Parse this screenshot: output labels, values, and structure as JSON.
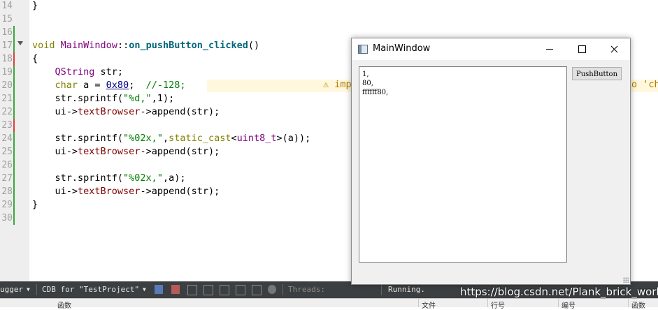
{
  "editor": {
    "lines": [
      {
        "num": "14",
        "text": "}"
      },
      {
        "num": "15",
        "text": ""
      },
      {
        "num": "16",
        "text": ""
      },
      {
        "num": "17",
        "text": "void MainWindow::on_pushButton_clicked()"
      },
      {
        "num": "18",
        "text": "{"
      },
      {
        "num": "19",
        "text": "    QString str;"
      },
      {
        "num": "20",
        "text": "    char a = 0x80;  //-128;"
      },
      {
        "num": "21",
        "text": "    str.sprintf(\"%d,\",1);"
      },
      {
        "num": "22",
        "text": "    ui->textBrowser->append(str);"
      },
      {
        "num": "23",
        "text": ""
      },
      {
        "num": "24",
        "text": "    str.sprintf(\"%02x,\",static_cast<uint8_t>(a));"
      },
      {
        "num": "25",
        "text": "    ui->textBrowser->append(str);"
      },
      {
        "num": "26",
        "text": ""
      },
      {
        "num": "27",
        "text": "    str.sprintf(\"%02x,\",a);"
      },
      {
        "num": "28",
        "text": "    ui->textBrowser->append(str);"
      },
      {
        "num": "29",
        "text": "}"
      },
      {
        "num": "30",
        "text": ""
      }
    ],
    "warning_left": "⚠ imp",
    "warning_right": "o 'ch"
  },
  "window": {
    "title": "MainWindow",
    "text_browser_lines": [
      "1,",
      "80,",
      "ffffff80,"
    ],
    "push_button_label": "PushButton"
  },
  "statusbar": {
    "debugger": "ugger",
    "engine": "CDB for \"TestProject\"",
    "threads_label": "Threads:",
    "status": "Running."
  },
  "bottom_header": {
    "col1": "函数",
    "col2": "文件",
    "col3": "行号",
    "col4": "编号",
    "col5": "函数"
  },
  "watermark": "https://blog.csdn.net/Plank_brick_work",
  "colors": {
    "keyword": "#808000",
    "function": "#00677c",
    "type": "#800080",
    "member": "#800000",
    "string": "#008000",
    "number": "#000080"
  }
}
